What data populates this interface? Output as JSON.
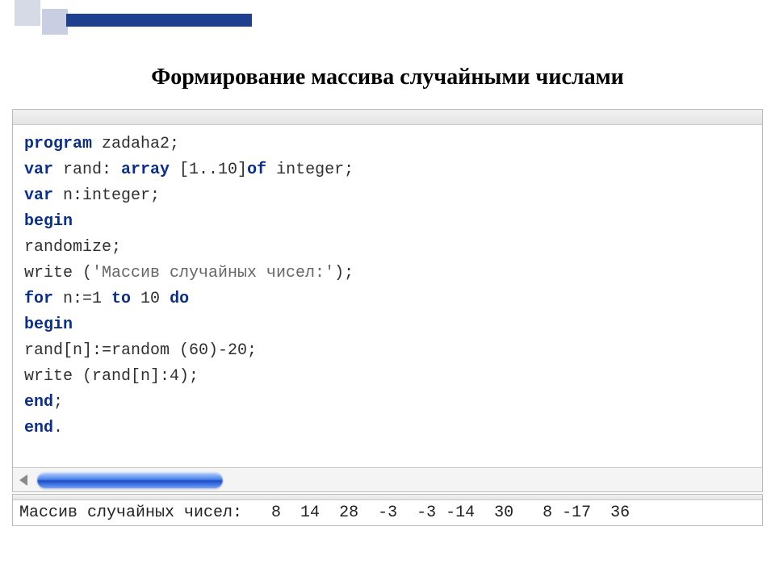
{
  "title": "Формирование массива случайными числами",
  "code": {
    "line1": {
      "kw1": "program",
      "rest": " zadaha2;"
    },
    "line2": {
      "kw1": "var",
      "mid1": " rand: ",
      "kw2": "array",
      "mid2": " [1..10]",
      "kw3": "of",
      "rest": " integer;"
    },
    "line3": {
      "kw1": "var",
      "rest": " n:integer;"
    },
    "line4": {
      "kw1": "begin"
    },
    "line5": {
      "text": "randomize;"
    },
    "line6": {
      "pre": "write (",
      "str": "'Массив случайных чисел:'",
      "post": ");"
    },
    "line7": {
      "kw1": "for",
      "mid1": " n:=1 ",
      "kw2": "to",
      "mid2": " 10 ",
      "kw3": "do"
    },
    "line8": {
      "kw1": "begin"
    },
    "line9": {
      "text": "rand[n]:=random (60)-20;"
    },
    "line10": {
      "text": "write (rand[n]:4);"
    },
    "line11": {
      "kw1": "end",
      "rest": ";"
    },
    "line12": {
      "kw1": "end",
      "rest": "."
    }
  },
  "output": "Массив случайных чисел:   8  14  28  -3  -3 -14  30   8 -17  36"
}
